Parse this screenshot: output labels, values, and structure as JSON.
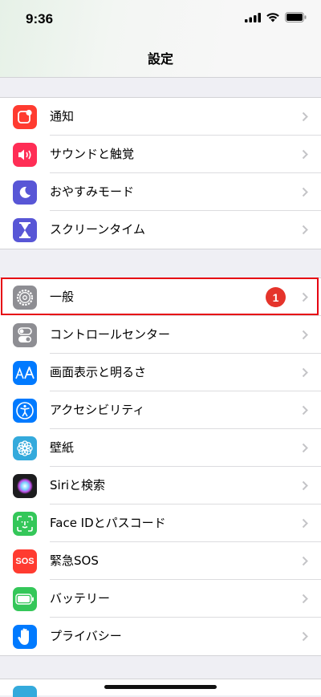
{
  "status_bar": {
    "time": "9:36"
  },
  "nav": {
    "title": "設定"
  },
  "group1": [
    {
      "label": "通知",
      "icon": "notifications-icon",
      "color": "#ff3b30"
    },
    {
      "label": "サウンドと触覚",
      "icon": "speaker-icon",
      "color": "#ff2d55"
    },
    {
      "label": "おやすみモード",
      "icon": "moon-icon",
      "color": "#5856d6"
    },
    {
      "label": "スクリーンタイム",
      "icon": "hourglass-icon",
      "color": "#5856d6"
    }
  ],
  "group2": [
    {
      "label": "一般",
      "icon": "gear-icon",
      "color": "#8e8e93",
      "badge": "1"
    },
    {
      "label": "コントロールセンター",
      "icon": "toggles-icon",
      "color": "#8e8e93"
    },
    {
      "label": "画面表示と明るさ",
      "icon": "text-size-icon",
      "color": "#007aff"
    },
    {
      "label": "アクセシビリティ",
      "icon": "accessibility-icon",
      "color": "#007aff"
    },
    {
      "label": "壁紙",
      "icon": "flower-icon",
      "color": "#34aadc"
    },
    {
      "label": "Siriと検索",
      "icon": "siri-icon",
      "color": "#1c1c1e"
    },
    {
      "label": "Face IDとパスコード",
      "icon": "face-id-icon",
      "color": "#34c759"
    },
    {
      "label": "緊急SOS",
      "icon": "sos-icon",
      "color": "#ff3b30",
      "icon_text": "SOS"
    },
    {
      "label": "バッテリー",
      "icon": "battery-icon",
      "color": "#34c759"
    },
    {
      "label": "プライバシー",
      "icon": "hand-icon",
      "color": "#007aff"
    }
  ]
}
